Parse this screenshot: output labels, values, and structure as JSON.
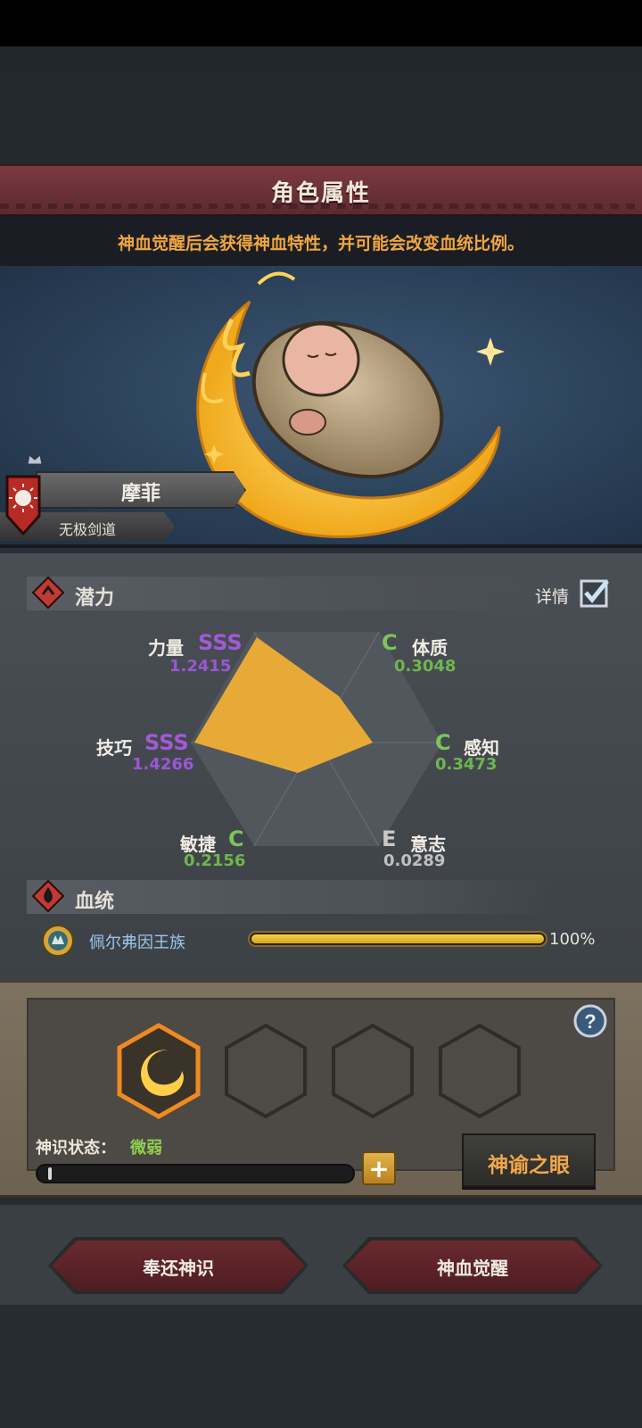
{
  "header": {
    "title": "角色属性",
    "hint": "神血觉醒后会获得神血特性，并可能会改变血统比例。"
  },
  "character": {
    "name": "摩菲",
    "title": "无极剑道"
  },
  "potential": {
    "section_label": "潜力",
    "detail_label": "详情",
    "detail_checked": true,
    "stats": [
      {
        "name": "力量",
        "grade": "SSS",
        "value": "1.2415"
      },
      {
        "name": "体质",
        "grade": "C",
        "value": "0.3048"
      },
      {
        "name": "感知",
        "grade": "C",
        "value": "0.3473"
      },
      {
        "name": "意志",
        "grade": "E",
        "value": "0.0289"
      },
      {
        "name": "敏捷",
        "grade": "C",
        "value": "0.2156"
      },
      {
        "name": "技巧",
        "grade": "SSS",
        "value": "1.4266"
      }
    ]
  },
  "lineage": {
    "section_label": "血统",
    "name": "佩尔弗因王族",
    "percent": "100%",
    "fill": 1.0
  },
  "divine": {
    "state_label": "神识状态：",
    "state_value": "微弱",
    "state_fill": 0.02,
    "oracle_button": "神谕之眼",
    "help_icon": "question-icon"
  },
  "actions": {
    "return_button": "奉还神识",
    "awaken_button": "神血觉醒"
  },
  "colors": {
    "accent_gold": "#f0a541",
    "sss": "#a25ad8",
    "grade_c": "#7bc45a",
    "title_band": "#6a3035"
  }
}
